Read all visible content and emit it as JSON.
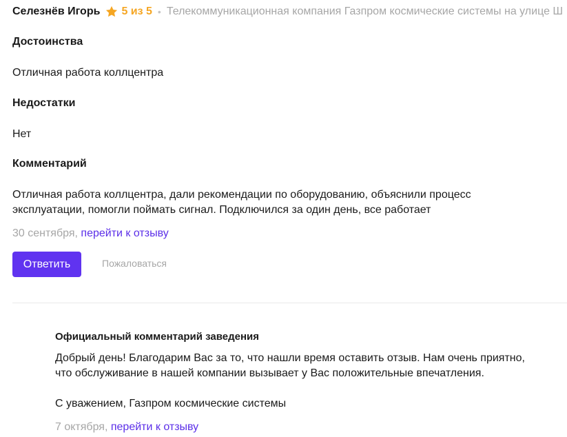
{
  "review": {
    "author": "Селезнёв Игорь",
    "rating_text": "5 из 5",
    "separator": "•",
    "company": "Телекоммуникационная компания Газпром космические системы на улице Ш",
    "pros_title": "Достоинства",
    "pros_text": "Отличная работа коллцентра",
    "cons_title": "Недостатки",
    "cons_text": "Нет",
    "comment_title": "Комментарий",
    "comment_line1": "Отличная работа коллцентра, дали рекомендации по оборудованию, объяснили процесс",
    "comment_line2": "эксплуатации, помогли поймать сигнал. Подключился за один день, все работает",
    "date": "30 сентября,",
    "goto_link": "перейти к отзыву",
    "reply_label": "Ответить",
    "complain_label": "Пожаловаться"
  },
  "official": {
    "title": "Официальный комментарий заведения",
    "line1": "Добрый день! Благодарим Вас за то, что нашли время оставить отзыв. Нам очень приятно,",
    "line2": "что обслуживание в нашей компании вызывает у Вас положительные впечатления.",
    "signature": "С уважением, Газпром космические системы",
    "date": "7 октября,",
    "goto_link": "перейти к отзыву"
  },
  "colors": {
    "accent": "#6033f0",
    "link": "#5b2ee8",
    "rating": "#f5a623",
    "muted": "#a6a6a6"
  },
  "icons": {
    "rating": "star-icon"
  }
}
